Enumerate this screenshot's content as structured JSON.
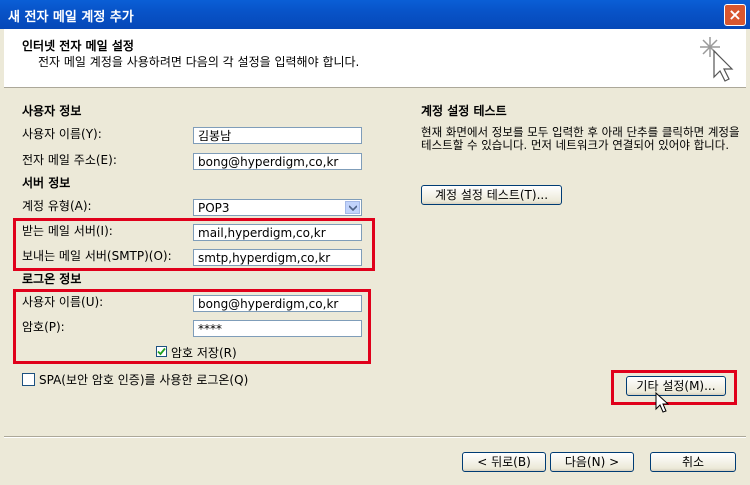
{
  "window": {
    "title": "새 전자 메일 계정 추가",
    "close": "×"
  },
  "header": {
    "title": "인터넷 전자 메일 설정",
    "subtitle": "전자 메일 계정을 사용하려면 다음의 각 설정을 입력해야 합니다."
  },
  "user_info": {
    "heading": "사용자 정보",
    "name_label": "사용자 이름(Y):",
    "name_value": "김봉남",
    "email_label": "전자 메일 주소(E):",
    "email_value": "bong@hyperdigm,co,kr"
  },
  "server_info": {
    "heading": "서버 정보",
    "account_type_label": "계정 유형(A):",
    "account_type_value": "POP3",
    "incoming_label": "받는 메일 서버(I):",
    "incoming_value": "mail,hyperdigm,co,kr",
    "outgoing_label": "보내는 메일 서버(SMTP)(O):",
    "outgoing_value": "smtp,hyperdigm,co,kr"
  },
  "logon_info": {
    "heading": "로그온 정보",
    "username_label": "사용자 이름(U):",
    "username_value": "bong@hyperdigm,co,kr",
    "password_label": "암호(P):",
    "password_value": "****",
    "remember_label": "암호 저장(R)",
    "remember_checked": true,
    "spa_label": "SPA(보안 암호 인증)를 사용한 로그온(Q)",
    "spa_checked": false
  },
  "test": {
    "heading": "계정 설정 테스트",
    "description": "현재 화면에서 정보를 모두 입력한 후 아래 단추를 클릭하면 계정을 테스트할 수 있습니다. 먼저 네트워크가 연결되어 있어야 합니다.",
    "button": "계정 설정 테스트(T)..."
  },
  "more_settings_button": "기타 설정(M)...",
  "footer": {
    "back": "< 뒤로(B)",
    "next": "다음(N) >",
    "cancel": "취소"
  },
  "colors": {
    "highlight": "#e0001b",
    "title_bar": "#0853c8"
  }
}
